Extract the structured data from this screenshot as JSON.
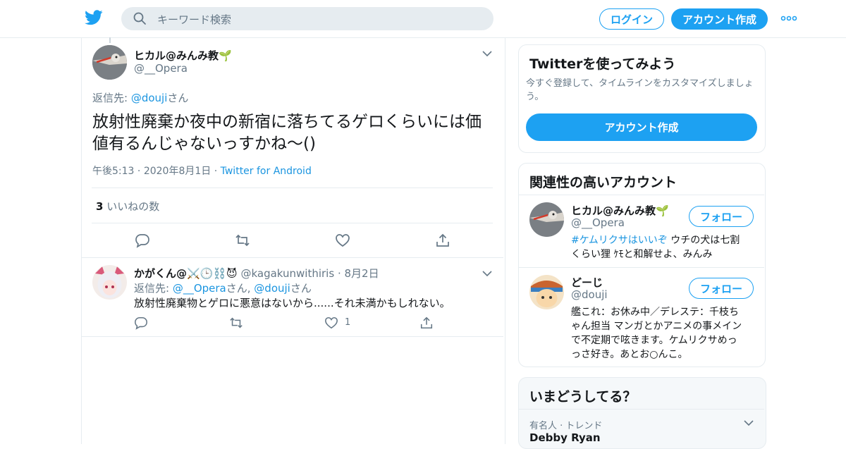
{
  "header": {
    "search_placeholder": "キーワード検索",
    "login_label": "ログイン",
    "signup_label": "アカウント作成"
  },
  "main_tweet": {
    "display_name": "ヒカル@みんみ教🌱",
    "handle": "@__Opera",
    "reply_prefix": "返信先: ",
    "reply_to": "@douji",
    "reply_suffix": "さん",
    "text_line1": "放射性廃棄か夜中の新宿に落ちてるゲロくらいには価",
    "text_line2": "値有るんじゃないっすかね～()",
    "time": "午後5:13",
    "date": "2020年8月1日",
    "source": "Twitter for Android",
    "likes_count": "3",
    "likes_label": "いいねの数"
  },
  "reply_tweet": {
    "display_name": "かがくん@⚔️🕒⛓️😈",
    "handle": "@kagakunwithiris",
    "date": "8月2日",
    "reply_prefix": "返信先: ",
    "reply_to_1": "@__Opera",
    "reply_mid": "さん, ",
    "reply_to_2": "@douji",
    "reply_suffix": "さん",
    "text": "放射性廃棄物とゲロに悪意はないから......それ未満かもしれない。",
    "like_count": "1"
  },
  "signup_card": {
    "title": "Twitterを使ってみよう",
    "description_line1": "今すぐ登録して、タイムラインをカスタマイズしましょ",
    "description_line2": "う。",
    "button": "アカウント作成"
  },
  "related_card": {
    "title": "関連性の高いアカウント",
    "follow_label": "フォロー",
    "accounts": [
      {
        "name": "ヒカル@みんみ教🌱",
        "handle": "@__Opera",
        "bio_hashtag": "#ケムリクサはいいぞ",
        "bio_line1_rest": " ウチの犬は七割",
        "bio_line2": "くらい狸 ｹﾓと和解せよ、みんみ"
      },
      {
        "name": "どーじ",
        "handle": "@douji",
        "bio_line1": "艦これ：お休み中／デレステ：千枝ち",
        "bio_line2": "ゃん担当 マンガとかアニメの事メイン",
        "bio_line3": "で不定期で呟きます。ケムリクサめっ",
        "bio_line4": "っさ好き。あとお○んこ。"
      }
    ]
  },
  "trends_card": {
    "title": "いまどうしてる？",
    "trend_context": "有名人 · トレンド",
    "trend_name": "Debby Ryan"
  },
  "colors": {
    "brand_blue": "#1da1f2",
    "link_blue": "#1b95e0",
    "muted": "#657786",
    "border": "#e6ecf0"
  },
  "icons": [
    "twitter-bird-icon",
    "search-icon",
    "more-icon",
    "chevron-down-icon",
    "reply-icon",
    "retweet-icon",
    "like-icon",
    "share-icon"
  ]
}
